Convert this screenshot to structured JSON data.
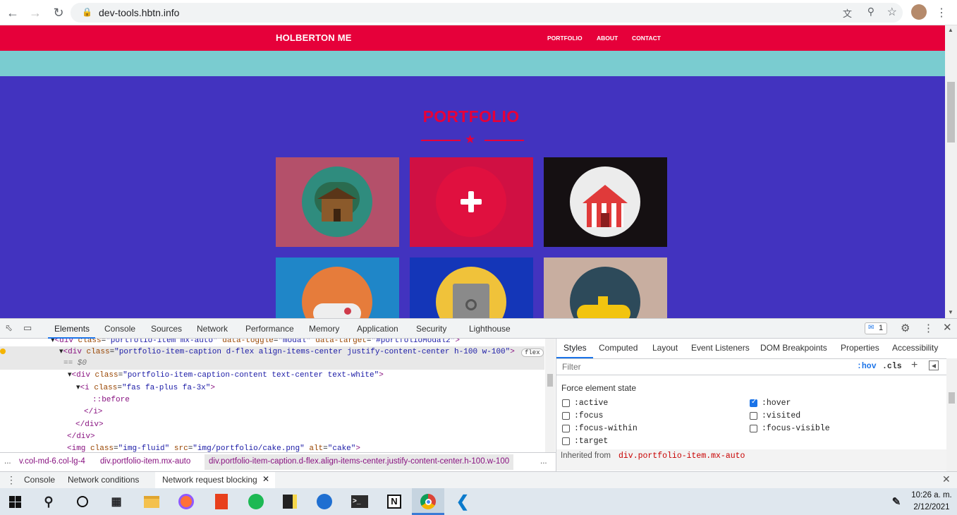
{
  "browser": {
    "url": "dev-tools.hbtn.info",
    "back_icon": "arrow-left-icon",
    "forward_icon": "arrow-right-icon",
    "reload_icon": "reload-icon"
  },
  "site": {
    "brand": "HOLBERTON ME",
    "nav": [
      "PORTFOLIO",
      "ABOUT",
      "CONTACT"
    ],
    "section_title": "PORTFOLIO",
    "colors": {
      "nav": "#e6003a",
      "band": "#7accd0",
      "section": "#4233bf"
    }
  },
  "devtools": {
    "tabs": [
      "Elements",
      "Console",
      "Sources",
      "Network",
      "Performance",
      "Memory",
      "Application",
      "Security",
      "Lighthouse"
    ],
    "issues_count": "1",
    "dom_lines": {
      "l1": {
        "tag": "<div ",
        "a1": "class",
        "v1": "\"portfolio-item mx-auto\"",
        "a2": "data-toggle",
        "v2": "\"modal\"",
        "a3": "data-target",
        "v3": "\"#portfolioModal2\"",
        "end": ">"
      },
      "l2": {
        "tag": "<div ",
        "a1": "class",
        "v1": "\"portfolio-item-caption d-flex align-items-center justify-content-center h-100 w-100\"",
        "end": ">",
        "badge": "flex"
      },
      "l3": "== $0",
      "l4": {
        "tag": "<div ",
        "a1": "class",
        "v1": "\"portfolio-item-caption-content text-center text-white\"",
        "end": ">"
      },
      "l5": {
        "tag": "<i ",
        "a1": "class",
        "v1": "\"fas fa-plus fa-3x\"",
        "end": ">"
      },
      "l6": "::before",
      "l7": "</i>",
      "l8": "</div>",
      "l9": "</div>",
      "l10": {
        "tag": "<img ",
        "a1": "class",
        "v1": "\"img-fluid\"",
        "a2": "src",
        "v2": "\"img/portfolio/cake.png\"",
        "a3": "alt",
        "v3": "\"cake\"",
        "end": ">"
      }
    },
    "breadcrumbs": [
      "...",
      "v.col-md-6.col-lg-4",
      "div.portfolio-item.mx-auto",
      "div.portfolio-item-caption.d-flex.align-items-center.justify-content-center.h-100.w-100",
      "..."
    ],
    "styles_tabs": [
      "Styles",
      "Computed",
      "Layout",
      "Event Listeners",
      "DOM Breakpoints",
      "Properties",
      "Accessibility"
    ],
    "filter_placeholder": "Filter",
    "hov": ":hov",
    "cls": ".cls",
    "force_state_title": "Force element state",
    "states_left": [
      ":active",
      ":focus",
      ":focus-within",
      ":target"
    ],
    "states_right": [
      ":hover",
      ":visited",
      ":focus-visible"
    ],
    "hover_checked": true,
    "inherited_label": "Inherited from",
    "inherited_selector": "div.portfolio-item.mx-auto",
    "drawer_tabs": [
      "Console",
      "Network conditions",
      "Network request blocking"
    ]
  },
  "taskbar": {
    "time": "10:26 a. m.",
    "date": "2/12/2021"
  }
}
